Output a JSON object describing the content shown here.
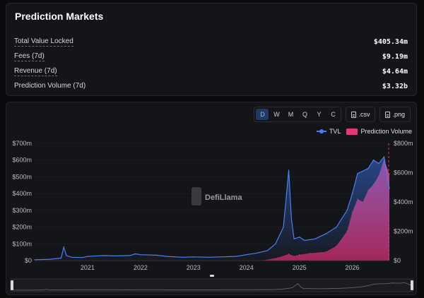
{
  "stats": {
    "title": "Prediction Markets",
    "rows": [
      {
        "label": "Total Value Locked",
        "value": "$405.34m"
      },
      {
        "label": "Fees (7d)",
        "value": "$9.19m"
      },
      {
        "label": "Revenue (7d)",
        "value": "$4.64m"
      },
      {
        "label": "Prediction Volume (7d)",
        "value": "$3.32b"
      }
    ]
  },
  "toolbar": {
    "intervals": [
      "D",
      "W",
      "M",
      "Q",
      "Y",
      "C"
    ],
    "active_interval": "D",
    "csv_label": ".csv",
    "png_label": ".png"
  },
  "watermark": "DefiLlama",
  "colors": {
    "tvl": "#4a7ff0",
    "volume": "#e23b73"
  },
  "chart_data": {
    "type": "area",
    "legend_position": "top-right",
    "series": [
      {
        "name": "TVL",
        "axis": "left",
        "type": "line",
        "x": [
          2020.0,
          2020.3,
          2020.5,
          2020.55,
          2020.6,
          2020.7,
          2020.9,
          2021.0,
          2021.3,
          2021.5,
          2021.8,
          2021.9,
          2022.0,
          2022.3,
          2022.5,
          2022.8,
          2023.0,
          2023.3,
          2023.5,
          2023.8,
          2024.0,
          2024.2,
          2024.4,
          2024.55,
          2024.7,
          2024.8,
          2024.85,
          2024.9,
          2025.0,
          2025.1,
          2025.3,
          2025.5,
          2025.7,
          2025.9,
          2026.0,
          2026.1,
          2026.3,
          2026.4,
          2026.5,
          2026.6,
          2026.7
        ],
        "values": [
          5,
          8,
          15,
          80,
          30,
          20,
          18,
          25,
          30,
          28,
          30,
          40,
          35,
          32,
          25,
          20,
          22,
          20,
          22,
          25,
          35,
          45,
          60,
          100,
          200,
          540,
          250,
          130,
          140,
          120,
          130,
          160,
          200,
          300,
          400,
          520,
          550,
          600,
          580,
          620,
          430
        ]
      },
      {
        "name": "Prediction Volume",
        "axis": "right",
        "type": "area",
        "x": [
          2024.3,
          2024.6,
          2024.8,
          2024.9,
          2025.0,
          2025.2,
          2025.5,
          2025.7,
          2025.9,
          2026.0,
          2026.1,
          2026.2,
          2026.3,
          2026.4,
          2026.5,
          2026.6,
          2026.7
        ],
        "values": [
          0,
          20,
          45,
          30,
          40,
          50,
          60,
          100,
          200,
          330,
          420,
          400,
          480,
          520,
          580,
          690,
          590
        ]
      }
    ],
    "x_ticks": [
      "2021",
      "2022",
      "2023",
      "2024",
      "2025",
      "2026"
    ],
    "x_range": [
      2020.0,
      2026.7
    ],
    "y_left": {
      "ticks": [
        "$0",
        "$100m",
        "$200m",
        "$300m",
        "$400m",
        "$500m",
        "$600m",
        "$700m"
      ],
      "range": [
        0,
        700
      ]
    },
    "y_right": {
      "ticks": [
        "$0",
        "$200m",
        "$400m",
        "$600m",
        "$800m"
      ],
      "range": [
        0,
        800
      ]
    }
  }
}
